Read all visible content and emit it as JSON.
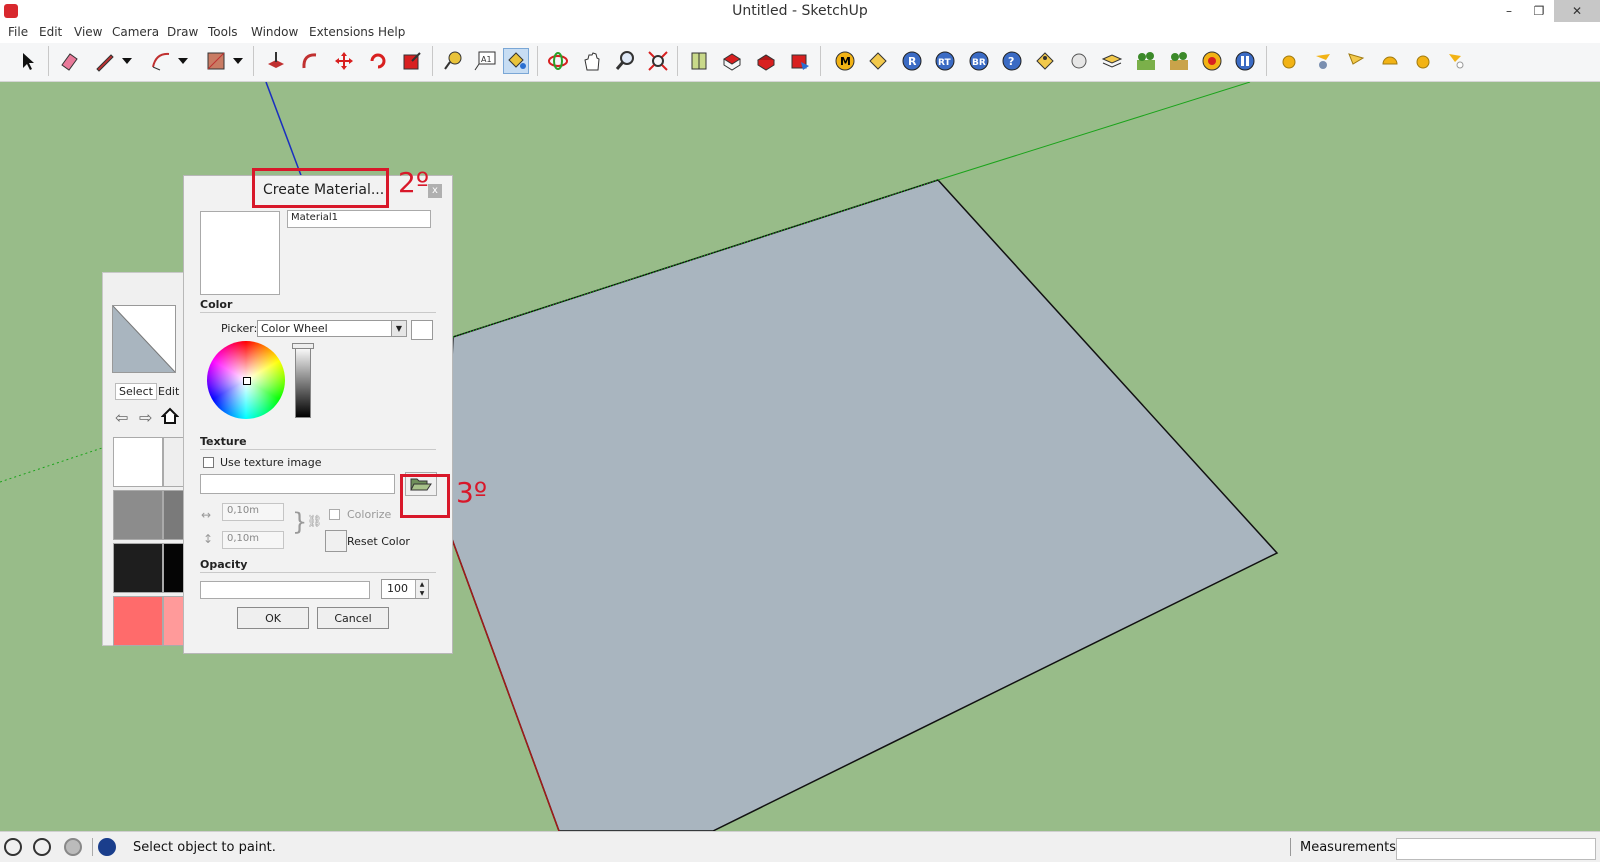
{
  "window": {
    "title": "Untitled - SketchUp",
    "minimize_glyph": "–",
    "restore_glyph": "❐",
    "close_glyph": "✕"
  },
  "menu": [
    "File",
    "Edit",
    "View",
    "Camera",
    "Draw",
    "Tools",
    "Window",
    "Extensions",
    "Help"
  ],
  "toolbar": {
    "text_tool_label": "A1",
    "extension_labels": [
      "M",
      "R",
      "RT",
      "BR",
      "?"
    ]
  },
  "materials_panel": {
    "tab_select": "Select",
    "tab_edit": "Edit",
    "swatch_colors": [
      "#ffffff",
      "#8c8c8c",
      "#1e1e1e",
      "#ff6b6b"
    ]
  },
  "create_material_dialog": {
    "title": "Create Material...",
    "close_glyph": "x",
    "material_name": "Material1",
    "color_section": "Color",
    "picker_label": "Picker:",
    "picker_value": "Color Wheel",
    "texture_section": "Texture",
    "use_texture_label": "Use texture image",
    "width_value": "0,10m",
    "height_value": "0,10m",
    "colorize_label": "Colorize",
    "reset_color_label": "Reset Color",
    "opacity_section": "Opacity",
    "opacity_value": "100",
    "ok_label": "OK",
    "cancel_label": "Cancel"
  },
  "annotations": {
    "step2": "2º",
    "step3": "3º"
  },
  "status": {
    "hint": "Select object to paint.",
    "measurements_label": "Measurements",
    "measurements_value": ""
  },
  "colors": {
    "viewport_bg": "#98bc89",
    "face_fill": "#a9b5bf",
    "annotation_red": "#d8182a",
    "green_axis": "#1aa31a",
    "blue_axis": "#1a2fbf",
    "red_axis": "#a01a1a"
  }
}
